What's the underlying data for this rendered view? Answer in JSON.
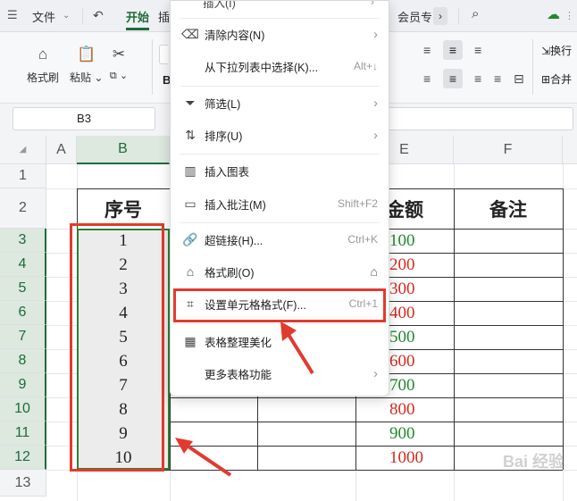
{
  "topbar": {
    "file_label": "文件",
    "start_tab": "开始",
    "insert_tab_partial": "插",
    "member_label": "会员专"
  },
  "ribbon": {
    "format_painter": "格式刷",
    "paste": "粘贴",
    "wrap_partial": "换行",
    "merge_partial": "合并"
  },
  "name_box": "B3",
  "columns": [
    "A",
    "B",
    "E",
    "F"
  ],
  "rows": [
    "1",
    "2",
    "3",
    "4",
    "5",
    "6",
    "7",
    "8",
    "9",
    "10",
    "11",
    "12",
    "13"
  ],
  "header_row": {
    "serial": "序号",
    "amount_partial": "金额",
    "remark": "备注"
  },
  "serials": [
    "1",
    "2",
    "3",
    "4",
    "5",
    "6",
    "7",
    "8",
    "9",
    "10"
  ],
  "amounts": [
    {
      "v": "100",
      "color": "#1f8a2a"
    },
    {
      "v": "200",
      "color": "#d42a1d"
    },
    {
      "v": "300",
      "color": "#d42a1d"
    },
    {
      "v": "400",
      "color": "#d42a1d"
    },
    {
      "v": "500",
      "color": "#1f8a2a"
    },
    {
      "v": "600",
      "color": "#d42a1d"
    },
    {
      "v": "700",
      "color": "#1f8a2a"
    },
    {
      "v": "800",
      "color": "#d42a1d"
    },
    {
      "v": "900",
      "color": "#1f8a2a"
    },
    {
      "v": "1000",
      "color": "#d42a1d"
    }
  ],
  "menu": {
    "items": [
      {
        "label": "清除内容(N)",
        "shortcut": ""
      },
      {
        "label": "从下拉列表中选择(K)...",
        "shortcut": "Alt+↓"
      },
      {
        "label": "筛选(L)",
        "shortcut": ""
      },
      {
        "label": "排序(U)",
        "shortcut": ""
      },
      {
        "label": "插入图表",
        "shortcut": ""
      },
      {
        "label": "插入批注(M)",
        "shortcut": "Shift+F2"
      },
      {
        "label": "超链接(H)...",
        "shortcut": "Ctrl+K"
      },
      {
        "label": "格式刷(O)",
        "shortcut": ""
      },
      {
        "label": "设置单元格格式(F)...",
        "shortcut": "Ctrl+1"
      },
      {
        "label": "表格整理美化",
        "shortcut": ""
      },
      {
        "label": "更多表格功能",
        "shortcut": ""
      }
    ]
  },
  "watermark": "Bai 经验",
  "colors": {
    "accent": "#1e6b3a",
    "highlight_red": "#e23a2e"
  }
}
